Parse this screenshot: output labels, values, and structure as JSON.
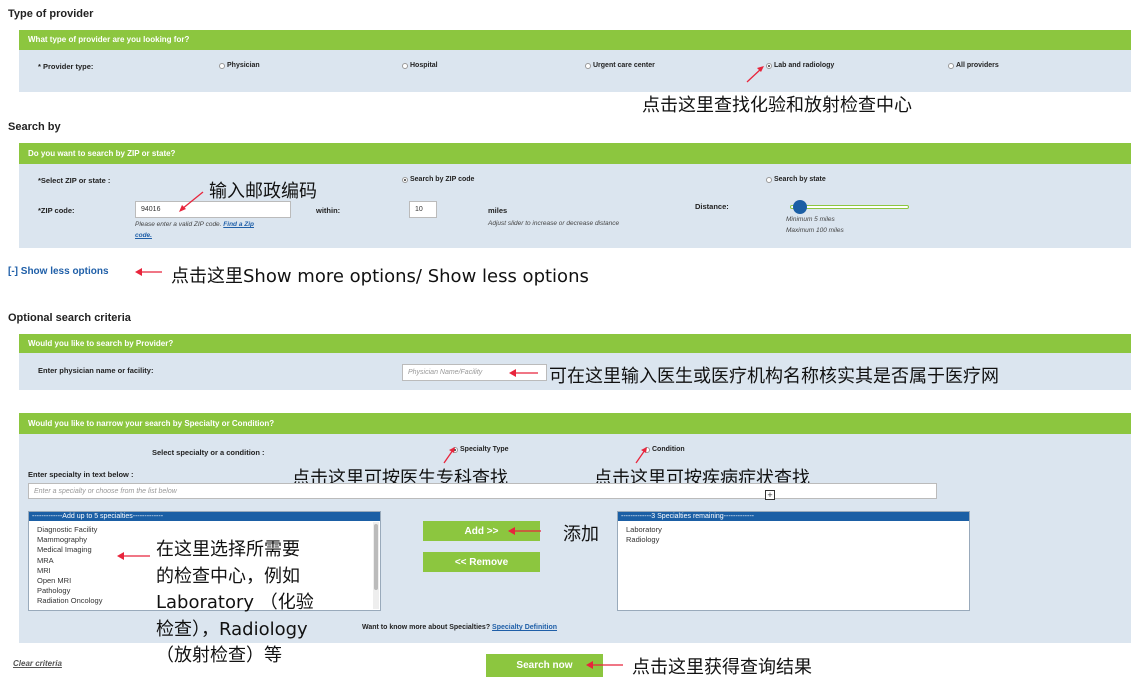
{
  "type_section": {
    "title": "Type of provider",
    "question": "What type of provider are you looking for?",
    "provider_label": "* Provider type:",
    "options": [
      "Physician",
      "Hospital",
      "Urgent care center",
      "Lab and radiology",
      "All providers"
    ]
  },
  "search_section": {
    "title": "Search by",
    "question": "Do you want to search by ZIP or state?",
    "select_label": "*Select ZIP or state :",
    "radio_zip": "Search by ZIP code",
    "radio_state": "Search by state",
    "zip_label": "*ZIP code:",
    "zip_value": "94016",
    "zip_hint": "Please enter a valid ZIP code.",
    "zip_link_1": "Find a Zip",
    "zip_link_2": "code.",
    "within_label": "within:",
    "within_value": "10",
    "miles_label": "miles",
    "slider_hint": "Adjust slider to increase or decrease distance",
    "distance_label": "Distance:",
    "distance_min": "Minimum 5 miles",
    "distance_max": "Maximum 100 miles",
    "distance_level": 0.04
  },
  "show_less": "[-] Show less options",
  "optional_section": {
    "title": "Optional search criteria",
    "provider_question": "Would you like to search by Provider?",
    "name_label": "Enter physician name or facility:",
    "name_placeholder": "Physician Name/Facility",
    "specialty_question": "Would you like to narrow your search by Specialty or Condition?",
    "select_label": "Select specialty or a condition :",
    "radio_specialty": "Specialty Type",
    "radio_condition": "Condition",
    "text_label": "Enter specialty in text below :",
    "text_placeholder": "Enter a specialty or choose from the list below",
    "left_list_header": "-------------Add up to 5 specialties-------------",
    "left_list": [
      "Diagnostic Facility",
      "Mammography",
      "Medical Imaging",
      "MRA",
      "MRI",
      "Open MRI",
      "Pathology",
      "Radiation Oncology"
    ],
    "add_button": "Add >>",
    "remove_button": "<< Remove",
    "right_list_header": "-------------3  Specialties remaining-------------",
    "right_list": [
      "Laboratory",
      "Radiology"
    ],
    "more_text": "Want to know more about Specialties?",
    "definition_link": "Specialty Definition"
  },
  "clear_criteria": "Clear criteria",
  "search_now": "Search now",
  "annotations": {
    "lab": "点击这里查找化验和放射检查中心",
    "zip": "输入邮政编码",
    "show_options": "点击这里Show more options/ Show less options",
    "name": "可在这里输入医生或医疗机构名称核实其是否属于医疗网",
    "specialty": "点击这里可按医生专科查找",
    "condition": "点击这里可按疾病症状查找",
    "add": "添加",
    "select_lines": [
      "在这里选择所需要",
      "的检查中心，例如",
      "Laboratory （化验",
      "检查），Radiology",
      "（放射检查）等"
    ],
    "search": "点击这里获得查询结果"
  },
  "colors": {
    "panel_header": "#8cc63f",
    "panel_body": "#dbe5ef",
    "list_header": "#1b5fa5",
    "annotation_arrow": "#e8253c",
    "link": "#1f5fa8"
  }
}
